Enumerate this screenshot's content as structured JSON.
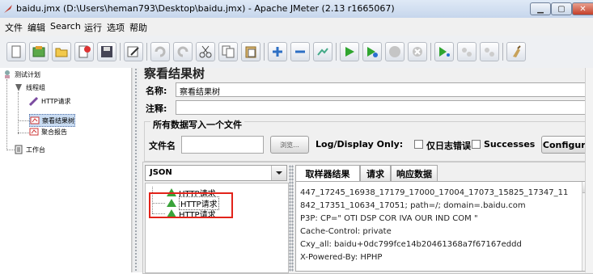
{
  "window": {
    "title": "baidu.jmx (D:\\Users\\heman793\\Desktop\\baidu.jmx) - Apache JMeter (2.13 r1665067)",
    "controls": [
      "minimize",
      "maximize",
      "close"
    ]
  },
  "menu": [
    "文件",
    "编辑",
    "Search",
    "运行",
    "选项",
    "帮助"
  ],
  "toolbar_icons": [
    "new-icon",
    "templates-icon",
    "open-icon",
    "close-icon",
    "save-icon",
    "save-as-icon",
    "undo-icon",
    "redo-icon",
    "cut-icon",
    "copy-icon",
    "paste-icon",
    "expand-icon",
    "collapse-icon",
    "toggle-icon",
    "start-icon",
    "start-no-pauses-icon",
    "stop-icon",
    "shutdown-icon",
    "remote-start-icon",
    "remote-stop-icon",
    "remote-shutdown-icon",
    "clear-icon"
  ],
  "tree": {
    "test_plan": "测试计划",
    "thread_group": "线程组",
    "http_request": "HTTP请求",
    "view_results_tree": "察看结果树",
    "aggregate_report": "聚合报告",
    "workbench": "工作台"
  },
  "panel": {
    "title": "察看结果树",
    "name_label": "名称:",
    "name_value": "察看结果树",
    "comment_label": "注释:",
    "comment_value": "",
    "group_title": "所有数据写入一个文件",
    "filename_label": "文件名",
    "filename_value": "",
    "browse_label": "浏览...",
    "log_display_label": "Log/Display Only:",
    "errors_label": "仅日志错误",
    "successes_label": "Successes",
    "configure_label": "Configure"
  },
  "results": {
    "renderer": "JSON",
    "samples": [
      "HTTP请求",
      "HTTP请求",
      "HTTP请求"
    ],
    "selected_index": 1,
    "tabs": [
      "取样器结果",
      "请求",
      "响应数据"
    ],
    "active_tab": 0,
    "response_lines": [
      "447_17245_16938_17179_17000_17004_17073_15825_17347_11",
      "842_17351_10634_17051; path=/; domain=.baidu.com",
      "P3P: CP=\" OTI DSP COR IVA OUR IND COM \"",
      "Cache-Control: private",
      "Cxy_all: baidu+0dc799fce14b20461368a7f67167eddd",
      "X-Powered-By: HPHP"
    ]
  },
  "colors": {
    "highlight": "#e2231a",
    "success_icon": "#3aa33a",
    "titlebar": "#c6d6ec"
  }
}
